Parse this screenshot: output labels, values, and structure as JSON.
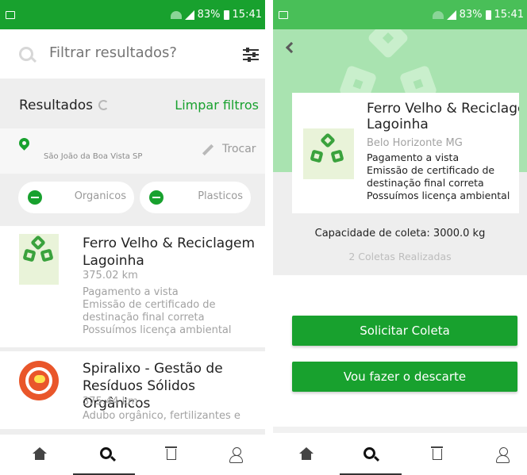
{
  "left": {
    "status": {
      "battery": "83%",
      "time": "15:41"
    },
    "filter": {
      "placeholder": "Filtrar resultados?"
    },
    "results": {
      "title": "Resultados",
      "clear": "Limpar filtros"
    },
    "location": {
      "city": "São João da Boa Vista  SP",
      "change": "Trocar"
    },
    "chips": [
      {
        "label": "Organicos"
      },
      {
        "label": "Plasticos"
      }
    ],
    "cards": [
      {
        "title": "Ferro Velho & Reciclagem Lagoinha",
        "distance": "375.02 km",
        "features": [
          "Pagamento a vista",
          "Emissão de certificado de destinação final correta",
          "Possuímos licença ambiental"
        ]
      },
      {
        "title": "Spiralixo - Gestão de Resíduos Sólidos Orgânicos",
        "distance": "375.44 km",
        "features": [
          "Adubo orgânico, fertilizantes e"
        ]
      }
    ],
    "nav": [
      "home-icon",
      "search-icon",
      "trash-icon",
      "user-icon"
    ]
  },
  "right": {
    "status": {
      "battery": "83%",
      "time": "15:41"
    },
    "detail": {
      "title_line1": "Ferro Velho & Reciclage",
      "title_line2": "Lagoinha",
      "city": "Belo Horizonte MG",
      "features": [
        "Pagamento a vista",
        "Emissão de certificado de",
        "destinação final correta",
        "Possuímos licença ambiental"
      ]
    },
    "capacity": "Capacidade de coleta: 3000.0 kg",
    "collects": "2 Coletas Realizadas",
    "buttons": {
      "request": "Solicitar Coleta",
      "discard": "Vou fazer o descarte"
    },
    "nav": [
      "home-icon",
      "search-icon",
      "trash-icon",
      "user-icon"
    ]
  },
  "colors": {
    "brand": "#18a12e",
    "hero": "#a9e3b0",
    "band": "#eeeeee"
  }
}
